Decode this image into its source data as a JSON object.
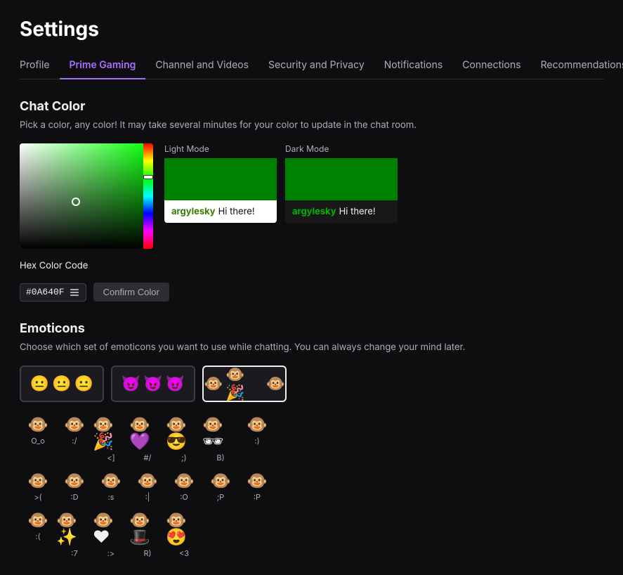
{
  "page": {
    "title": "Settings"
  },
  "nav": {
    "items": [
      {
        "id": "profile",
        "label": "Profile",
        "active": false
      },
      {
        "id": "prime-gaming",
        "label": "Prime Gaming",
        "active": true
      },
      {
        "id": "channel-videos",
        "label": "Channel and Videos",
        "active": false
      },
      {
        "id": "security-privacy",
        "label": "Security and Privacy",
        "active": false
      },
      {
        "id": "notifications",
        "label": "Notifications",
        "active": false
      },
      {
        "id": "connections",
        "label": "Connections",
        "active": false
      },
      {
        "id": "recommendations",
        "label": "Recommendations",
        "active": false
      }
    ]
  },
  "chat_color": {
    "section_title": "Chat Color",
    "description": "Pick a color, any color! It may take several minutes for your color to update in the chat room.",
    "hex_label": "Hex Color Code",
    "hex_value": "#0A640F",
    "confirm_label": "Confirm Color",
    "light_mode_label": "Light Mode",
    "dark_mode_label": "Dark Mode",
    "preview_username": "argylesky",
    "preview_message": "Hi there!",
    "color_hex": "#008000"
  },
  "emoticons": {
    "section_title": "Emoticons",
    "description": "Choose which set of emoticons you want to use while chatting. You can always change your mind later.",
    "options": [
      {
        "id": "default",
        "emojis": [
          "😐",
          "😐",
          "😐"
        ],
        "selected": false
      },
      {
        "id": "twitch",
        "emojis": [
          "😈",
          "😈",
          "😈"
        ],
        "selected": false
      },
      {
        "id": "monkey",
        "emojis": [
          "🐵",
          "🐵🎉",
          "🐵"
        ],
        "selected": true
      }
    ],
    "items": [
      {
        "emoji": "🐵",
        "code": "O_o"
      },
      {
        "emoji": "🐵",
        "code": ":/"
      },
      {
        "emoji": "🐵🎉",
        "code": "<]"
      },
      {
        "emoji": "🐵💜",
        "code": "#/"
      },
      {
        "emoji": "🐵😎",
        "code": ";)"
      },
      {
        "emoji": "🐵🕶",
        "code": "B)"
      },
      {
        "emoji": "🐵",
        "code": ":)"
      },
      {
        "emoji": "🐵",
        "code": ">("
      },
      {
        "emoji": "🐵",
        "code": ":D"
      },
      {
        "emoji": "🐵",
        "code": ":s"
      },
      {
        "emoji": "🐵",
        "code": ":|"
      },
      {
        "emoji": "🐵",
        "code": ":O"
      },
      {
        "emoji": "🐵",
        "code": ";P"
      },
      {
        "emoji": "🐵",
        "code": ":P"
      },
      {
        "emoji": "🐵",
        "code": ":("
      },
      {
        "emoji": "🐵✨",
        "code": ":7"
      },
      {
        "emoji": "🐵❤",
        "code": ":>"
      },
      {
        "emoji": "🐵🎩",
        "code": "R)"
      },
      {
        "emoji": "🐵😍",
        "code": "<3"
      }
    ]
  }
}
